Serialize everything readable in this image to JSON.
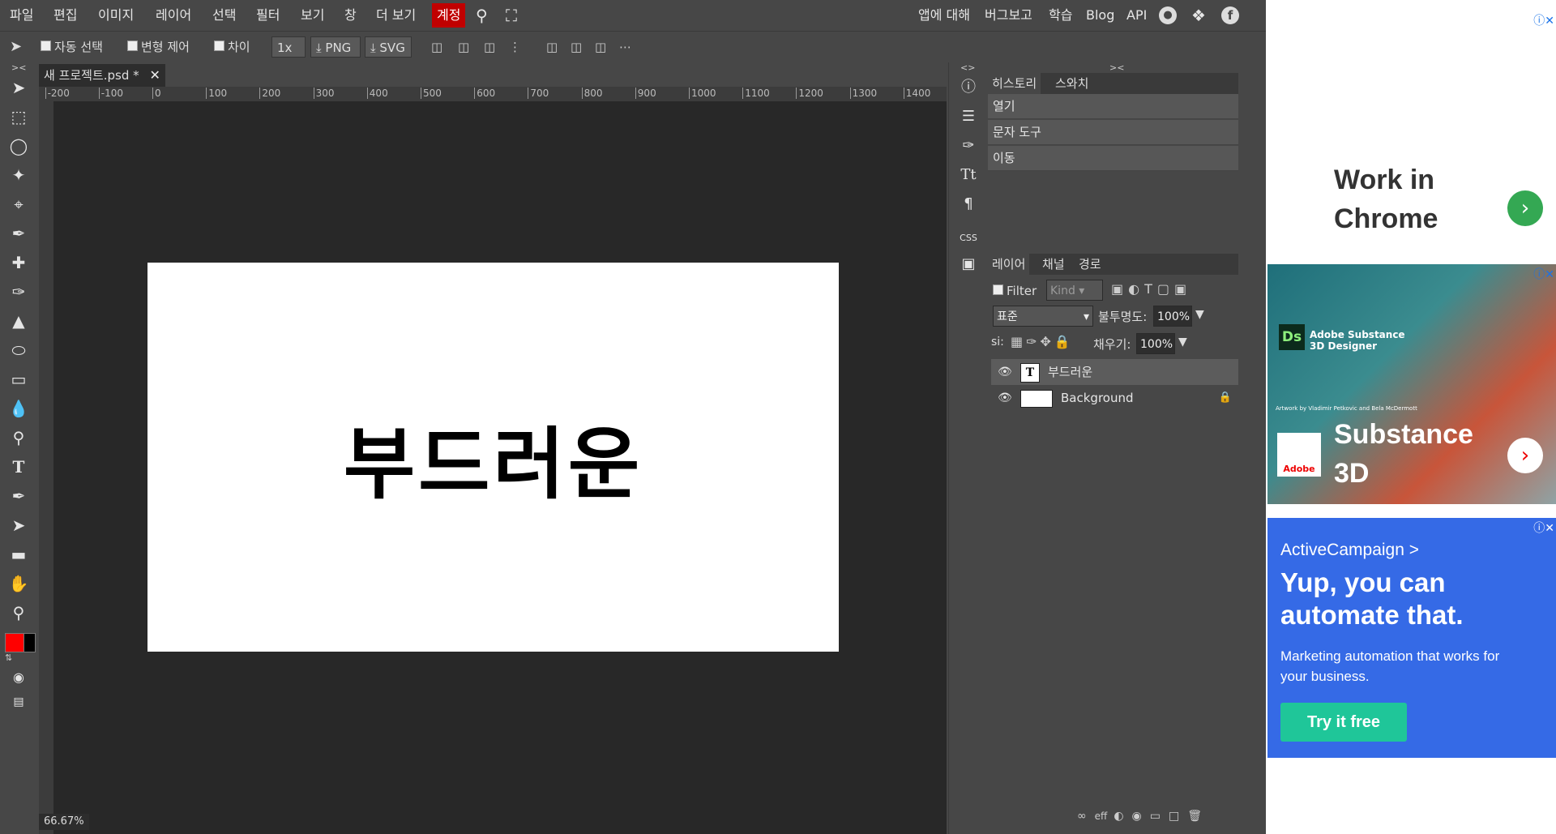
{
  "menu": {
    "items": [
      "파일",
      "편집",
      "이미지",
      "레이어",
      "선택",
      "필터",
      "보기",
      "창",
      "더 보기"
    ],
    "account": "계정",
    "right_links": [
      "앱에 대해",
      "버그보고",
      "학습",
      "Blog",
      "API"
    ]
  },
  "options": {
    "auto_select": "자동 선택",
    "transform_controls": "변형 제어",
    "distances": "차이",
    "scale": "1x",
    "png": "PNG",
    "svg": "SVG"
  },
  "colors": {
    "accent": "#c00000",
    "foreground": "#ff0000",
    "background": "#000000",
    "ad_green": "#34a853",
    "ad_blue": "#356ae6",
    "ad_btn": "#1fc699"
  },
  "document": {
    "tab_title": "새 프로젝트.psd *",
    "canvas_text": "부드러운",
    "zoom": "66.67%",
    "ruler_labels": [
      "-200",
      "-100",
      "0",
      "100",
      "200",
      "300",
      "400",
      "500",
      "600",
      "700",
      "800",
      "900",
      "1000",
      "1100",
      "1200",
      "1300",
      "1400"
    ]
  },
  "history_panel": {
    "tabs": [
      "히스토리",
      "스와치"
    ],
    "items": [
      "열기",
      "문자 도구",
      "이동"
    ]
  },
  "layers_panel": {
    "tabs": [
      "레이어",
      "채널",
      "경로"
    ],
    "filter_label": "Filter",
    "kind_label": "Kind",
    "blend_mode": "표준",
    "opacity_label": "불투명도:",
    "opacity_value": "100%",
    "lock_label": "si:",
    "fill_label": "채우기:",
    "fill_value": "100%",
    "layers": [
      {
        "name": "부드러운",
        "type": "text"
      },
      {
        "name": "Background",
        "type": "image"
      }
    ],
    "footer_eff": "eff"
  },
  "ads": {
    "ad1": {
      "headline": "Work in Chrome"
    },
    "ad2": {
      "brand": "Adobe Substance 3D Designer",
      "badge": "Ds",
      "logo_text": "Adobe",
      "headline": "Substance 3D",
      "credit": "Artwork by Vladimir Petkovic and Bela McDermott"
    },
    "ad3": {
      "brand": "ActiveCampaign >",
      "headline": "Yup, you can automate that.",
      "body": "Marketing automation that works for your business.",
      "cta": "Try it free"
    }
  }
}
